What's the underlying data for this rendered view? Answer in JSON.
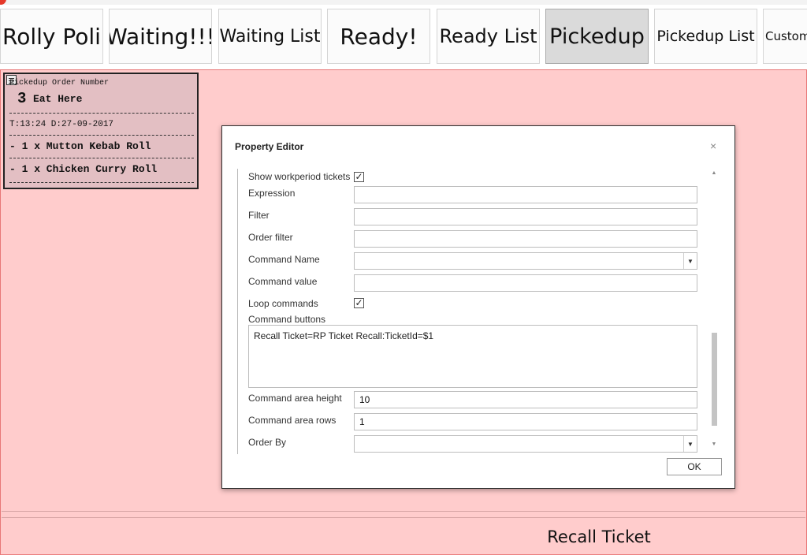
{
  "tabs": [
    {
      "label": "Rolly Poli",
      "active": false
    },
    {
      "label": "Waiting!!!",
      "active": false
    },
    {
      "label": "Waiting List",
      "active": false
    },
    {
      "label": "Ready!",
      "active": false
    },
    {
      "label": "Ready List",
      "active": false
    },
    {
      "label": "Pickedup",
      "active": true
    },
    {
      "label": "Pickedup List",
      "active": false
    },
    {
      "label": "Custom",
      "active": false
    }
  ],
  "ticket": {
    "header": "Pickedup Order Number",
    "number": "3",
    "type": "Eat Here",
    "time_date": "T:13:24   D:27-09-2017",
    "items": [
      "- 1 x Mutton Kebab Roll",
      "- 1 x Chicken Curry Roll"
    ]
  },
  "dialog": {
    "title": "Property Editor",
    "close_glyph": "×",
    "ok_label": "OK",
    "properties": {
      "show_workperiod_tickets": {
        "label": "Show workperiod tickets",
        "checked": true
      },
      "expression": {
        "label": "Expression",
        "value": ""
      },
      "filter": {
        "label": "Filter",
        "value": ""
      },
      "order_filter": {
        "label": "Order filter",
        "value": ""
      },
      "command_name": {
        "label": "Command Name",
        "value": ""
      },
      "command_value": {
        "label": "Command value",
        "value": ""
      },
      "loop_commands": {
        "label": "Loop commands",
        "checked": true
      },
      "command_buttons": {
        "label": "Command buttons",
        "value": "Recall Ticket=RP Ticket Recall:TicketId=$1"
      },
      "command_area_height": {
        "label": "Command area height",
        "value": "10"
      },
      "command_area_rows": {
        "label": "Command area rows",
        "value": "1"
      },
      "order_by": {
        "label": "Order By",
        "value": ""
      }
    },
    "check_glyph": "✓"
  },
  "recall_button": {
    "label": "Recall Ticket"
  },
  "colors": {
    "panel_bg": "#ffcccc",
    "ticket_bg": "#e3bfc3",
    "tab_active_bg": "#dadada"
  }
}
